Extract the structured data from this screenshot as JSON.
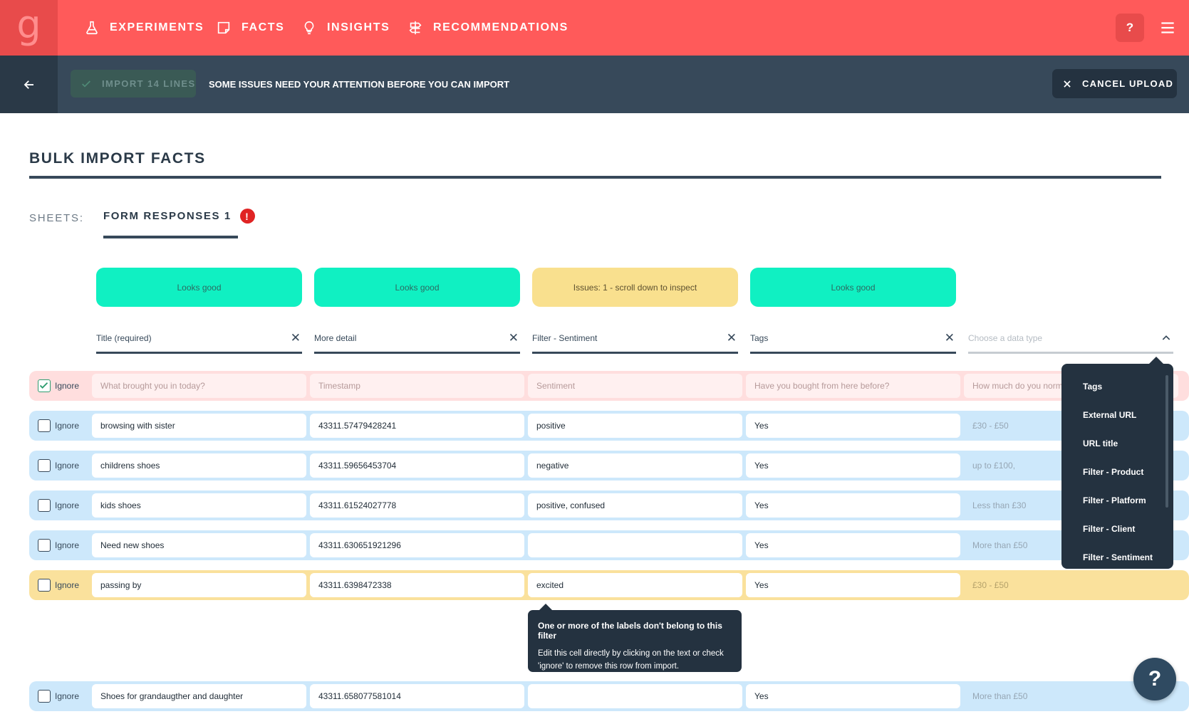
{
  "nav": {
    "logo": "g",
    "items": [
      {
        "label": "EXPERIMENTS",
        "icon": "flask-icon"
      },
      {
        "label": "FACTS",
        "icon": "note-icon"
      },
      {
        "label": "INSIGHTS",
        "icon": "lightbulb-icon"
      },
      {
        "label": "RECOMMENDATIONS",
        "icon": "signpost-icon"
      }
    ],
    "help_label": "?",
    "colors": {
      "bar": "#ff5a5a",
      "logo_bg": "#e84b4b"
    }
  },
  "actionbar": {
    "import_label": "IMPORT 14 LINES",
    "message": "SOME ISSUES NEED YOUR ATTENTION BEFORE YOU CAN IMPORT",
    "cancel_label": "CANCEL UPLOAD"
  },
  "page": {
    "title": "BULK IMPORT FACTS",
    "sheets_label": "SHEETS:",
    "sheet_tab": "FORM RESPONSES 1",
    "sheet_error": "!"
  },
  "status_cards": [
    {
      "text": "Looks good",
      "state": "good"
    },
    {
      "text": "Looks good",
      "state": "good"
    },
    {
      "text": "Issues: 1 - scroll down to inspect",
      "state": "issue"
    },
    {
      "text": "Looks good",
      "state": "good"
    }
  ],
  "columns": [
    {
      "label": "Title (required)"
    },
    {
      "label": "More detail"
    },
    {
      "label": "Filter - Sentiment"
    },
    {
      "label": "Tags"
    },
    {
      "label": "Choose a data type"
    }
  ],
  "ignore_label": "Ignore",
  "rows": [
    {
      "state": "header",
      "checked": true,
      "cells": [
        "What brought you in today?",
        "Timestamp",
        "Sentiment",
        "Have you bought from here before?",
        "How much do you norm"
      ]
    },
    {
      "state": "ok",
      "checked": false,
      "cells": [
        "browsing with sister",
        "43311.57479428241",
        "positive",
        "Yes",
        "£30 - £50"
      ]
    },
    {
      "state": "ok",
      "checked": false,
      "cells": [
        "childrens shoes",
        "43311.59656453704",
        "negative",
        "Yes",
        "up to £100,"
      ]
    },
    {
      "state": "ok",
      "checked": false,
      "cells": [
        "kids shoes",
        "43311.61524027778",
        "positive, confused",
        "Yes",
        "Less than £30"
      ]
    },
    {
      "state": "ok",
      "checked": false,
      "cells": [
        "Need new shoes",
        "43311.630651921296",
        "",
        "Yes",
        "More than £50"
      ]
    },
    {
      "state": "issue",
      "checked": false,
      "cells": [
        "passing by",
        "43311.6398472338",
        "excited",
        "Yes",
        "£30 - £50"
      ]
    },
    {
      "state": "ok",
      "checked": false,
      "cells": [
        "Shoes for grandaugther and daughter",
        "43311.658077581014",
        "",
        "Yes",
        "More than £50"
      ]
    }
  ],
  "dropdown": {
    "options": [
      "Tags",
      "External URL",
      "URL title",
      "Filter - Product",
      "Filter - Platform",
      "Filter - Client",
      "Filter - Sentiment"
    ]
  },
  "tooltip": {
    "title": "One or more of the labels don't belong to this filter",
    "body": "Edit this cell directly by clicking on the text or check 'ignore' to remove this row from import."
  },
  "fab_label": "?"
}
